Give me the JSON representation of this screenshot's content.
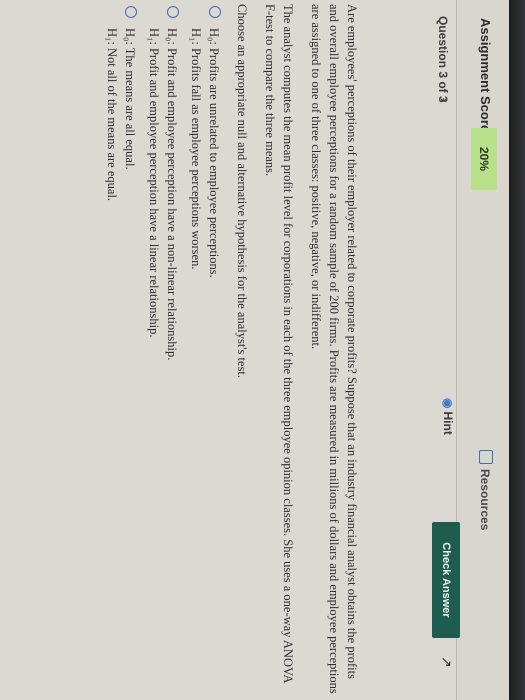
{
  "header": {
    "score_label": "Assignment Score:",
    "score_value": "20%",
    "resources_label": "Resources",
    "hint_label": "Hint",
    "check_answer_label": "Check Answer"
  },
  "nav": {
    "question_counter": "Question 3 of 3",
    "next_icon": "chevron-right-icon"
  },
  "question": {
    "paragraph": "Are employees' perceptions of their employer related to corporate profits? Suppose that an industry financial analyst obtains the profits and overall employee perceptions for a random sample of 200 firms. Profits are measured in millions of dollars and employee perceptions are assigned to one of three classes: positive, negative, or indifferent.",
    "paragraph2": "The analyst computes the mean profit level for corporations in each of the three employee opinion classes. She uses a one-way ANOVA F-test to compare the three means.",
    "prompt": "Choose an appropriate null and alternative hypothesis for the analyst's test.",
    "options": [
      {
        "h0": "H₀: Profits are unrelated to employee perceptions.",
        "h1": "H₁: Profits fall as employee perceptions worsen."
      },
      {
        "h0": "H₀: Profit and employee perception have a non-linear relationship.",
        "h1": "H₁: Profit and employee perception have a linear relationship."
      },
      {
        "h0": "H₀: The means are all equal.",
        "h1": "H₁: Not all of the means are equal."
      }
    ]
  }
}
